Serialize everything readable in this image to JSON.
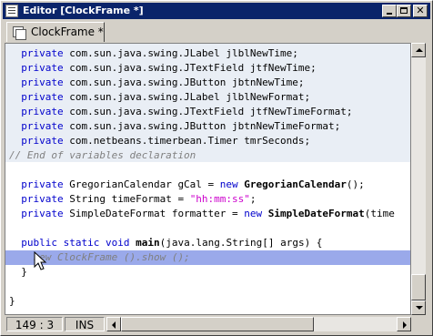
{
  "window": {
    "title": "Editor [ClockFrame *]"
  },
  "tabs": [
    {
      "label": "ClockFrame *"
    }
  ],
  "code": {
    "lines": [
      {
        "indent": "  ",
        "tokens": [
          {
            "t": "private",
            "c": "kw2"
          },
          {
            "t": " com.sun.java.swing.JLabel jlblNewTime;",
            "c": ""
          }
        ]
      },
      {
        "indent": "  ",
        "tokens": [
          {
            "t": "private",
            "c": "kw2"
          },
          {
            "t": " com.sun.java.swing.JTextField jtfNewTime;",
            "c": ""
          }
        ]
      },
      {
        "indent": "  ",
        "tokens": [
          {
            "t": "private",
            "c": "kw2"
          },
          {
            "t": " com.sun.java.swing.JButton jbtnNewTime;",
            "c": ""
          }
        ]
      },
      {
        "indent": "  ",
        "tokens": [
          {
            "t": "private",
            "c": "kw2"
          },
          {
            "t": " com.sun.java.swing.JLabel jlblNewFormat;",
            "c": ""
          }
        ]
      },
      {
        "indent": "  ",
        "tokens": [
          {
            "t": "private",
            "c": "kw2"
          },
          {
            "t": " com.sun.java.swing.JTextField jtfNewTimeFormat;",
            "c": ""
          }
        ]
      },
      {
        "indent": "  ",
        "tokens": [
          {
            "t": "private",
            "c": "kw2"
          },
          {
            "t": " com.sun.java.swing.JButton jbtnNewTimeFormat;",
            "c": ""
          }
        ]
      },
      {
        "indent": "  ",
        "tokens": [
          {
            "t": "private",
            "c": "kw2"
          },
          {
            "t": " com.netbeans.timerbean.Timer tmrSeconds;",
            "c": ""
          }
        ]
      },
      {
        "indent": "",
        "tokens": [
          {
            "t": "// End of variables declaration",
            "c": "cm"
          }
        ]
      },
      {
        "indent": "",
        "tokens": []
      },
      {
        "indent": "  ",
        "tokens": [
          {
            "t": "private",
            "c": "kw2"
          },
          {
            "t": " GregorianCalendar gCal = ",
            "c": ""
          },
          {
            "t": "new",
            "c": "kw2"
          },
          {
            "t": " ",
            "c": ""
          },
          {
            "t": "GregorianCalendar",
            "c": "bold"
          },
          {
            "t": "();",
            "c": ""
          }
        ]
      },
      {
        "indent": "  ",
        "tokens": [
          {
            "t": "private",
            "c": "kw2"
          },
          {
            "t": " String timeFormat = ",
            "c": ""
          },
          {
            "t": "\"hh:mm:ss\"",
            "c": "str"
          },
          {
            "t": ";",
            "c": ""
          }
        ]
      },
      {
        "indent": "  ",
        "tokens": [
          {
            "t": "private",
            "c": "kw2"
          },
          {
            "t": " SimpleDateFormat formatter = ",
            "c": ""
          },
          {
            "t": "new",
            "c": "kw2"
          },
          {
            "t": " ",
            "c": ""
          },
          {
            "t": "SimpleDateFormat",
            "c": "bold"
          },
          {
            "t": "(time",
            "c": ""
          }
        ]
      },
      {
        "indent": "",
        "tokens": []
      },
      {
        "indent": "  ",
        "tokens": [
          {
            "t": "public",
            "c": "kw2"
          },
          {
            "t": " ",
            "c": ""
          },
          {
            "t": "static",
            "c": "kw2"
          },
          {
            "t": " ",
            "c": ""
          },
          {
            "t": "void",
            "c": "kw2"
          },
          {
            "t": " ",
            "c": ""
          },
          {
            "t": "main",
            "c": "bold"
          },
          {
            "t": "(java.lang.String[] args) {",
            "c": ""
          }
        ]
      },
      {
        "indent": "    ",
        "tokens": [
          {
            "t": "new ClockFrame ().show ();",
            "c": "cm"
          }
        ],
        "current": true
      },
      {
        "indent": "  ",
        "tokens": [
          {
            "t": "}",
            "c": ""
          }
        ]
      },
      {
        "indent": "",
        "tokens": []
      },
      {
        "indent": "",
        "tokens": [
          {
            "t": "}",
            "c": ""
          }
        ]
      }
    ]
  },
  "status": {
    "position": "149 : 3",
    "mode": "INS"
  },
  "scroll": {
    "vertical_fraction": 0.91,
    "horizontal_fraction": 0.0
  },
  "colors": {
    "title_bar": "#0a246a",
    "guarded_block": "#e9eef5",
    "current_line": "#9aa9ea",
    "keyword": "#0000cc",
    "string": "#cc00cc",
    "comment": "#808080"
  }
}
